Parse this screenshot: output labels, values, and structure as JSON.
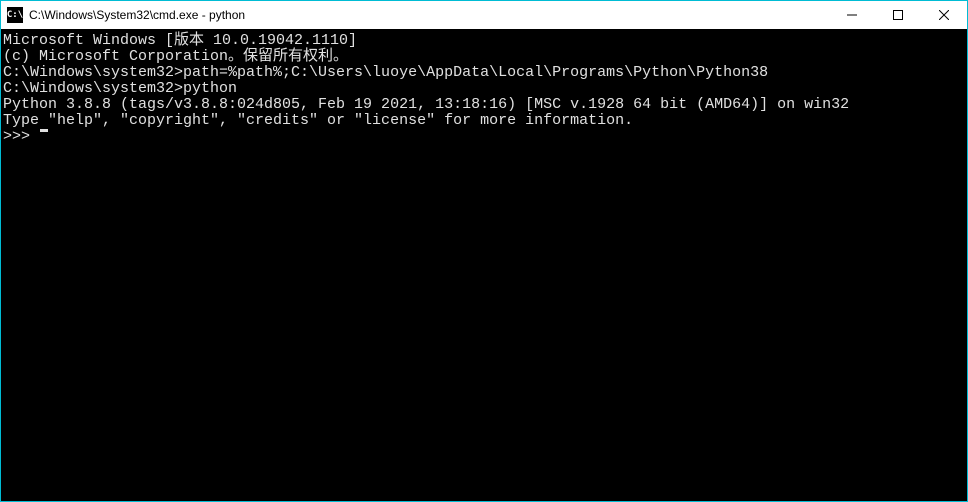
{
  "window": {
    "title": "C:\\Windows\\System32\\cmd.exe - python"
  },
  "terminal": {
    "lines": [
      "Microsoft Windows [版本 10.0.19042.1110]",
      "(c) Microsoft Corporation。保留所有权利。",
      "",
      "C:\\Windows\\system32>path=%path%;C:\\Users\\luoye\\AppData\\Local\\Programs\\Python\\Python38",
      "",
      "C:\\Windows\\system32>python",
      "Python 3.8.8 (tags/v3.8.8:024d805, Feb 19 2021, 13:18:16) [MSC v.1928 64 bit (AMD64)] on win32",
      "Type \"help\", \"copyright\", \"credits\" or \"license\" for more information."
    ],
    "prompt": ">>> "
  }
}
